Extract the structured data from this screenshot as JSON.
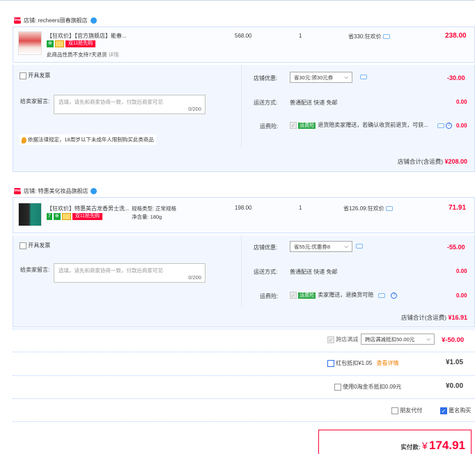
{
  "shops": [
    {
      "shop_label": "店铺: recheers丽春旗舰店",
      "item": {
        "title": "【狂欢价】【官方旗舰店】能春...",
        "sku": "",
        "badge_text": "双11抢先购",
        "note": "此商品性质不支持7天退货",
        "note_link": "详情",
        "orig_price": "568.00",
        "qty": "1",
        "discount_text": "省330:狂欢价",
        "price": "238.00"
      },
      "invoice_label": "开具发票",
      "message_label": "给卖家留言:",
      "message_placeholder": "选填，请先和商家协商一致，付款后商家可见",
      "message_counter": "0/200",
      "legal_notice": "依据法律规定，18周岁以下未成年人限制购买此类商品",
      "coupon_label": "店铺优惠:",
      "coupon_value": "省30元:领30元券",
      "coupon_amount": "-30.00",
      "delivery_label": "运送方式:",
      "delivery_value": "普通配送 快递 免邮",
      "delivery_amount": "0.00",
      "insurance_label": "运费险:",
      "insurance_tag": "运费险",
      "insurance_text": "退货赔卖家赠送，若确认收货前退货，可获...",
      "insurance_amount": "0.00",
      "subtotal_label": "店铺合计(含运费)",
      "subtotal_value": "¥208.00"
    },
    {
      "shop_label": "店铺: 特惠美化妆品旗舰店",
      "item": {
        "title": "【狂欢价】特惠美古龙香男士洗...",
        "sku_line1": "规格类型: 正常规格",
        "sku_line2": "净含量: 180g",
        "badge_num": "7",
        "badge_text": "双11抢先购",
        "orig_price": "198.00",
        "qty": "1",
        "discount_text": "省126.09:狂欢价",
        "price": "71.91"
      },
      "invoice_label": "开具发票",
      "message_label": "给卖家留言:",
      "message_placeholder": "选填，请先和商家协商一致，付款后商家可见",
      "message_counter": "0/200",
      "coupon_label": "店铺优惠:",
      "coupon_value": "省55元:优惠券8",
      "coupon_amount": "-55.00",
      "delivery_label": "运送方式:",
      "delivery_value": "普通配送 快递 免邮",
      "delivery_amount": "0.00",
      "insurance_label": "运费险:",
      "insurance_tag": "运费险",
      "insurance_text": "卖家赠送，退换货可赔",
      "insurance_amount": "0.00",
      "subtotal_label": "店铺合计(含运费)",
      "subtotal_value": "¥16.91"
    }
  ],
  "cross_store": {
    "label": "跨店满减",
    "select": "跨店满减抵扣50.00元",
    "amount": "¥-50.00"
  },
  "red_packet": {
    "label": "红包抵扣¥1.05",
    "link": "查看详情",
    "amount": "¥1.05"
  },
  "coins": {
    "label": "使用0淘金币抵扣0.09元",
    "amount": "¥0.00"
  },
  "friend_pay_label": "朋友代付",
  "anonymous_label": "匿名购买",
  "total": {
    "label": "实付款:",
    "currency": "¥",
    "value": "174.91"
  }
}
